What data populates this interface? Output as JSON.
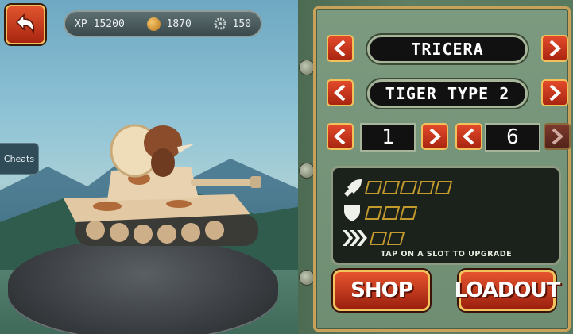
{
  "stats": {
    "xp_label": "XP",
    "xp_value": "15200",
    "coins": "1870",
    "gears": "150"
  },
  "cheats_label": "Cheats",
  "selectors": {
    "dino": "TRICERA",
    "tank": "TIGER TYPE 2",
    "left_number": "1",
    "right_number": "6"
  },
  "upgrades": {
    "hint": "TAP ON A SLOT TO UPGRADE",
    "rows": [
      {
        "icon": "rocket-icon",
        "slots": 5
      },
      {
        "icon": "shield-icon",
        "slots": 3
      },
      {
        "icon": "speed-chevrons-icon",
        "slots": 2
      }
    ]
  },
  "buttons": {
    "shop": "SHOP",
    "loadout": "LOADOUT"
  },
  "colors": {
    "accent_red": "#d43a1f",
    "gold_border": "#f1c25c",
    "panel_green": "#6f8d72",
    "slot_gold": "#c39a2d"
  }
}
